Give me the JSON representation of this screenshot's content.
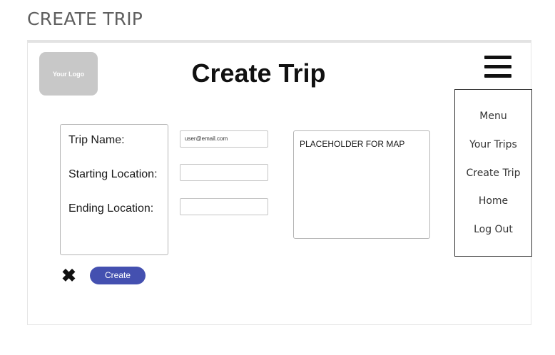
{
  "page_heading": "CREATE TRIP",
  "header": {
    "logo_text": "Your Logo",
    "title": "Create Trip"
  },
  "menu": {
    "items": [
      "Menu",
      "Your Trips",
      "Create Trip",
      "Home",
      "Log Out"
    ]
  },
  "form": {
    "trip_name_label": "Trip Name:",
    "trip_name_value": "user@email.com",
    "starting_location_label": "Starting Location:",
    "starting_location_value": "",
    "ending_location_label": "Ending Location:",
    "ending_location_value": ""
  },
  "map": {
    "placeholder_text": "PLACEHOLDER FOR MAP"
  },
  "actions": {
    "cancel_glyph": "✖",
    "create_label": "Create",
    "create_color": "#4450b0"
  }
}
